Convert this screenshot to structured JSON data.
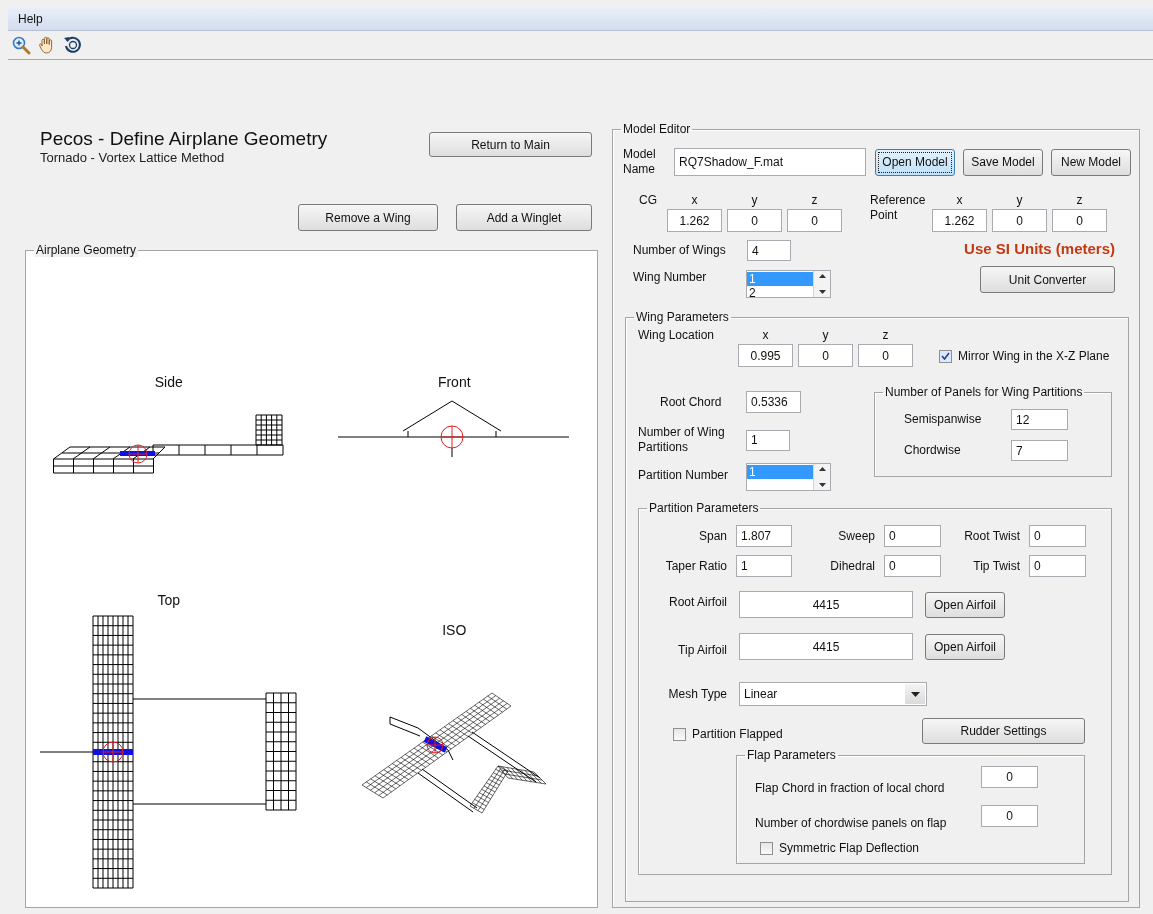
{
  "menu": [
    "Help"
  ],
  "toolbar": [
    {
      "kind": "zoom-in"
    },
    {
      "kind": "pan"
    },
    {
      "kind": "rotate"
    }
  ],
  "header": {
    "title": "Pecos - Define Airplane Geometry",
    "subtitle": "Tornado - Vortex Lattice Method",
    "return_button": "Return to Main"
  },
  "wing_buttons": [
    "Remove a Wing",
    "Add a Winglet"
  ],
  "geometry": {
    "title": "Airplane Geometry",
    "views": [
      {
        "kind": "side",
        "title": "Side"
      },
      {
        "kind": "front",
        "title": "Front"
      },
      {
        "kind": "top",
        "title": "Top"
      },
      {
        "kind": "iso",
        "title": "ISO"
      }
    ]
  },
  "model_editor": {
    "title": "Model Editor",
    "model_name_label": "Model Name",
    "model_name": "RQ7Shadow_F.mat",
    "buttons": [
      {
        "label": "Open Model",
        "focused": true
      },
      {
        "label": "Save Model",
        "focused": false
      },
      {
        "label": "New Model",
        "focused": false
      }
    ],
    "cg": {
      "label": "CG",
      "axes": [
        "x",
        "y",
        "z"
      ],
      "values": [
        "1.262",
        "0",
        "0"
      ]
    },
    "reference": {
      "label": "Reference Point",
      "axes": [
        "x",
        "y",
        "z"
      ],
      "values": [
        "1.262",
        "0",
        "0"
      ]
    },
    "number_of_wings": {
      "label": "Number of Wings",
      "value": "4"
    },
    "units_note": "Use SI Units (meters)",
    "wing_number": {
      "label": "Wing Number",
      "items": [
        {
          "text": "1",
          "selected": true
        },
        {
          "text": "2",
          "selected": false
        }
      ]
    },
    "unit_converter": "Unit Converter",
    "wing_parameters": {
      "title": "Wing Parameters",
      "location": {
        "label": "Wing Location",
        "axes": [
          "x",
          "y",
          "z"
        ],
        "values": [
          "0.995",
          "0",
          "0"
        ]
      },
      "mirror": {
        "label": "Mirror Wing in the X-Z Plane",
        "checked": true
      },
      "root_chord": {
        "label": "Root Chord",
        "value": "0.5336"
      },
      "partitions": {
        "label": "Number of Wing Partitions",
        "value": "1"
      },
      "partition_number": {
        "label": "Partition Number",
        "items": [
          {
            "text": "1",
            "selected": true
          }
        ]
      },
      "panels": {
        "title": "Number of Panels for Wing Partitions",
        "fields": [
          {
            "label": "Semispanwise",
            "value": "12"
          },
          {
            "label": "Chordwise",
            "value": "7"
          }
        ]
      },
      "partition_parameters": {
        "title": "Partition Parameters",
        "fields": [
          {
            "label": "Span",
            "value": "1.807"
          },
          {
            "label": "Sweep",
            "value": "0"
          },
          {
            "label": "Root Twist",
            "value": "0"
          },
          {
            "label": "Taper Ratio",
            "value": "1"
          },
          {
            "label": "Dihedral",
            "value": "0"
          },
          {
            "label": "Tip Twist",
            "value": "0"
          }
        ],
        "airfoils": [
          {
            "label": "Root Airfoil",
            "value": "4415",
            "button": "Open Airfoil"
          },
          {
            "label": "Tip Airfoil",
            "value": "4415",
            "button": "Open Airfoil"
          }
        ],
        "mesh_type": {
          "label": "Mesh Type",
          "value": "Linear"
        },
        "flapped": {
          "label": "Partition Flapped",
          "checked": false
        },
        "rudder_button": "Rudder Settings",
        "flap_parameters": {
          "title": "Flap Parameters",
          "fields": [
            {
              "label": "Flap Chord in fraction of local chord",
              "value": "0"
            },
            {
              "label": "Number of chordwise panels on flap",
              "value": "0"
            }
          ],
          "symmetric": {
            "label": "Symmetric Flap Deflection",
            "checked": false
          }
        }
      }
    }
  }
}
